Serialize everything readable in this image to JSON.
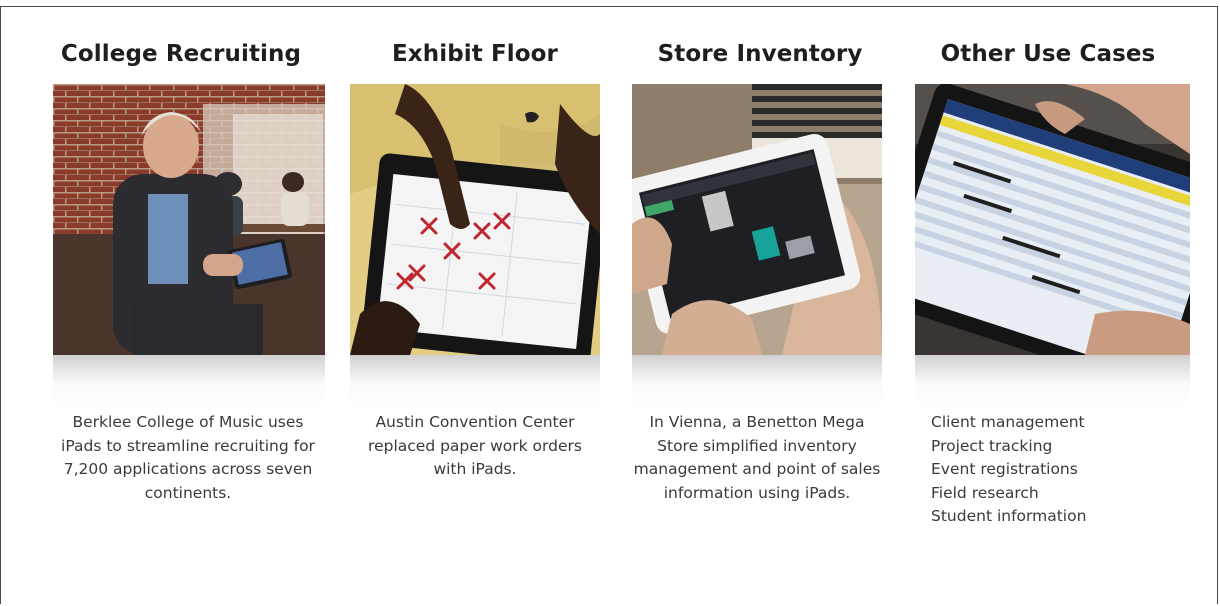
{
  "columns": [
    {
      "id": "college",
      "title": "College Recruiting",
      "description": "Berklee College of Music uses iPads to streamline recruiting for 7,200 applications across seven continents."
    },
    {
      "id": "exhibit",
      "title": "Exhibit Floor",
      "description": "Austin Convention Center replaced paper work orders with iPads."
    },
    {
      "id": "store",
      "title": "Store Inventory",
      "description": "In Vienna, a Benetton Mega Store simplified inventory management and point of sales information using iPads."
    },
    {
      "id": "other",
      "title": "Other Use Cases",
      "items": [
        "Client management",
        "Project tracking",
        "Event registrations",
        "Field research",
        "Student information"
      ]
    }
  ]
}
